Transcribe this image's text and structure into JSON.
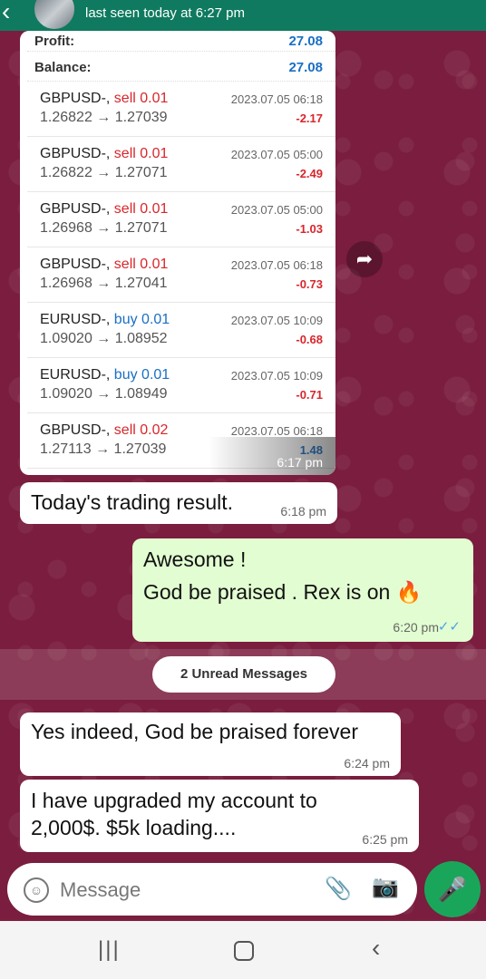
{
  "header": {
    "status": "last seen today at 6:27 pm",
    "icons": [
      "back-arrow-icon",
      "avatar",
      "video-call-icon",
      "phone-icon",
      "more-icon"
    ]
  },
  "screenshot": {
    "profit_label": "Profit:",
    "profit_value": "27.08",
    "balance_label": "Balance:",
    "balance_value": "27.08",
    "trades": [
      {
        "pair": "GBPUSD-,",
        "side": "sell",
        "lot": "0.01",
        "open": "1.26822",
        "close": "1.27039",
        "date": "2023.07.05 06:18",
        "pl": "-2.17"
      },
      {
        "pair": "GBPUSD-,",
        "side": "sell",
        "lot": "0.01",
        "open": "1.26822",
        "close": "1.27071",
        "date": "2023.07.05 05:00",
        "pl": "-2.49"
      },
      {
        "pair": "GBPUSD-,",
        "side": "sell",
        "lot": "0.01",
        "open": "1.26968",
        "close": "1.27071",
        "date": "2023.07.05 05:00",
        "pl": "-1.03"
      },
      {
        "pair": "GBPUSD-,",
        "side": "sell",
        "lot": "0.01",
        "open": "1.26968",
        "close": "1.27041",
        "date": "2023.07.05 06:18",
        "pl": "-0.73"
      },
      {
        "pair": "EURUSD-,",
        "side": "buy",
        "lot": "0.01",
        "open": "1.09020",
        "close": "1.08952",
        "date": "2023.07.05 10:09",
        "pl": "-0.68"
      },
      {
        "pair": "EURUSD-,",
        "side": "buy",
        "lot": "0.01",
        "open": "1.09020",
        "close": "1.08949",
        "date": "2023.07.05 10:09",
        "pl": "-0.71"
      },
      {
        "pair": "GBPUSD-,",
        "side": "sell",
        "lot": "0.02",
        "open": "1.27113",
        "close": "1.27039",
        "date": "2023.07.05 06:18",
        "pl": "1.48"
      }
    ],
    "time": "6:17 pm"
  },
  "messages": {
    "m1": {
      "text": "Today's trading result.",
      "time": "6:18 pm"
    },
    "m2": {
      "line1": "Awesome !",
      "line2": "God be praised . Rex is on 🔥",
      "time": "6:20 pm",
      "ticks": "✓✓"
    },
    "unread": "2 Unread Messages",
    "m3": {
      "text": "Yes indeed, God be praised forever",
      "time": "6:24 pm"
    },
    "m4": {
      "line1": "I have upgraded my account to",
      "line2": "2,000$. $5k loading....",
      "time": "6:25 pm"
    }
  },
  "composer": {
    "placeholder": "Message"
  },
  "colors": {
    "header": "#0f7a5f",
    "wallpaper": "#7a1d3e",
    "outgoing": "#e2fdd1",
    "sell": "#d8262b",
    "buy": "#1a6fc4",
    "mic": "#1aa65a"
  }
}
